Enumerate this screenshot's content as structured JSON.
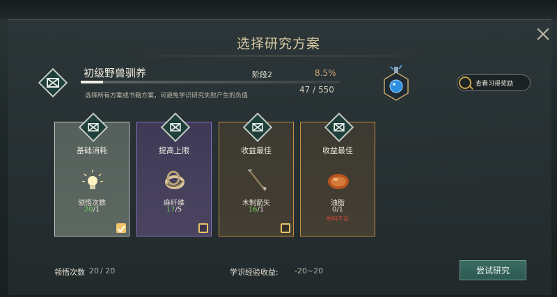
{
  "dialog": {
    "title": "选择研究方案"
  },
  "skill": {
    "name": "初级野兽驯养",
    "stage": "阶段2",
    "percent": "8.5%",
    "progress_fraction": 0.085,
    "progress_text": "47 / 550",
    "hint": "选择所有方案或书籍方案，可避免学识研究失败产生的负值"
  },
  "reward_button": {
    "label": "查看习得奖励"
  },
  "cards": [
    {
      "name": "基础消耗",
      "item_name": "领悟次数",
      "have": "20",
      "need": "/1",
      "checked": true,
      "icon": "light-bulb-icon"
    },
    {
      "name": "提高上限",
      "item_name": "麻纤维",
      "have": "17",
      "need": "/5",
      "checked": false,
      "icon": "fiber-coil-icon"
    },
    {
      "name": "收益最佳",
      "item_name": "木制箭矢",
      "have": "16",
      "need": "/1",
      "checked": false,
      "icon": "arrow-icon"
    },
    {
      "name": "收益最佳",
      "item_name": "油脂",
      "have": "0",
      "need": "/1",
      "shortage": "材料不足",
      "checked": false,
      "icon": "fat-blob-icon"
    }
  ],
  "footer": {
    "comprehension_label": "领悟次数",
    "comprehension_value": "20",
    "comprehension_max": "/ 20",
    "xp_label": "学识经验收益:",
    "xp_value": "-20~20"
  },
  "try_button": {
    "label": "尝试研究"
  },
  "colors": {
    "accent_gold": "#d9c9a3",
    "have_green": "#6fcf5a",
    "shortage_red": "#d84a3a",
    "button_teal": "#3a6b62"
  }
}
